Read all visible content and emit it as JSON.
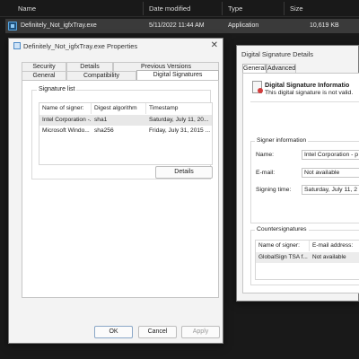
{
  "explorer": {
    "columns": [
      "Name",
      "Date modified",
      "Type",
      "Size"
    ],
    "file": {
      "name": "Definitely_Not_igfxTray.exe",
      "date": "5/11/2022 11:44 AM",
      "type": "Application",
      "size": "10,619 KB"
    }
  },
  "properties": {
    "title": "Definitely_Not_igfxTray.exe Properties",
    "close_icon": "✕",
    "tabs_row1": [
      "Security",
      "Details",
      "Previous Versions"
    ],
    "tabs_row2": [
      "General",
      "Compatibility",
      "Digital Signatures"
    ],
    "active_tab": "Digital Signatures",
    "signature_list_label": "Signature list",
    "columns": [
      "Name of signer:",
      "Digest algorithm",
      "Timestamp"
    ],
    "rows": [
      {
        "signer": "Intel Corporation -...",
        "digest": "sha1",
        "timestamp": "Saturday, July 11, 20..."
      },
      {
        "signer": "Microsoft Windo...",
        "digest": "sha256",
        "timestamp": "Friday, July 31, 2015 ..."
      }
    ],
    "details_button": "Details",
    "ok_button": "OK",
    "cancel_button": "Cancel",
    "apply_button": "Apply"
  },
  "signature_details": {
    "title": "Digital Signature Details",
    "tabs": [
      "General",
      "Advanced"
    ],
    "info_title": "Digital Signature Informatio",
    "info_text": "This digital signature is not valid.",
    "signer_group": "Signer information",
    "name_label": "Name:",
    "name_value": "Intel Corporation - p",
    "email_label": "E-mail:",
    "email_value": "Not available",
    "signing_time_label": "Signing time:",
    "signing_time_value": "Saturday, July 11, 2",
    "countersignatures_label": "Countersignatures",
    "cs_columns": [
      "Name of signer:",
      "E-mail address:"
    ],
    "cs_row": {
      "signer": "GlobalSign TSA f...",
      "email": "Not available"
    }
  }
}
